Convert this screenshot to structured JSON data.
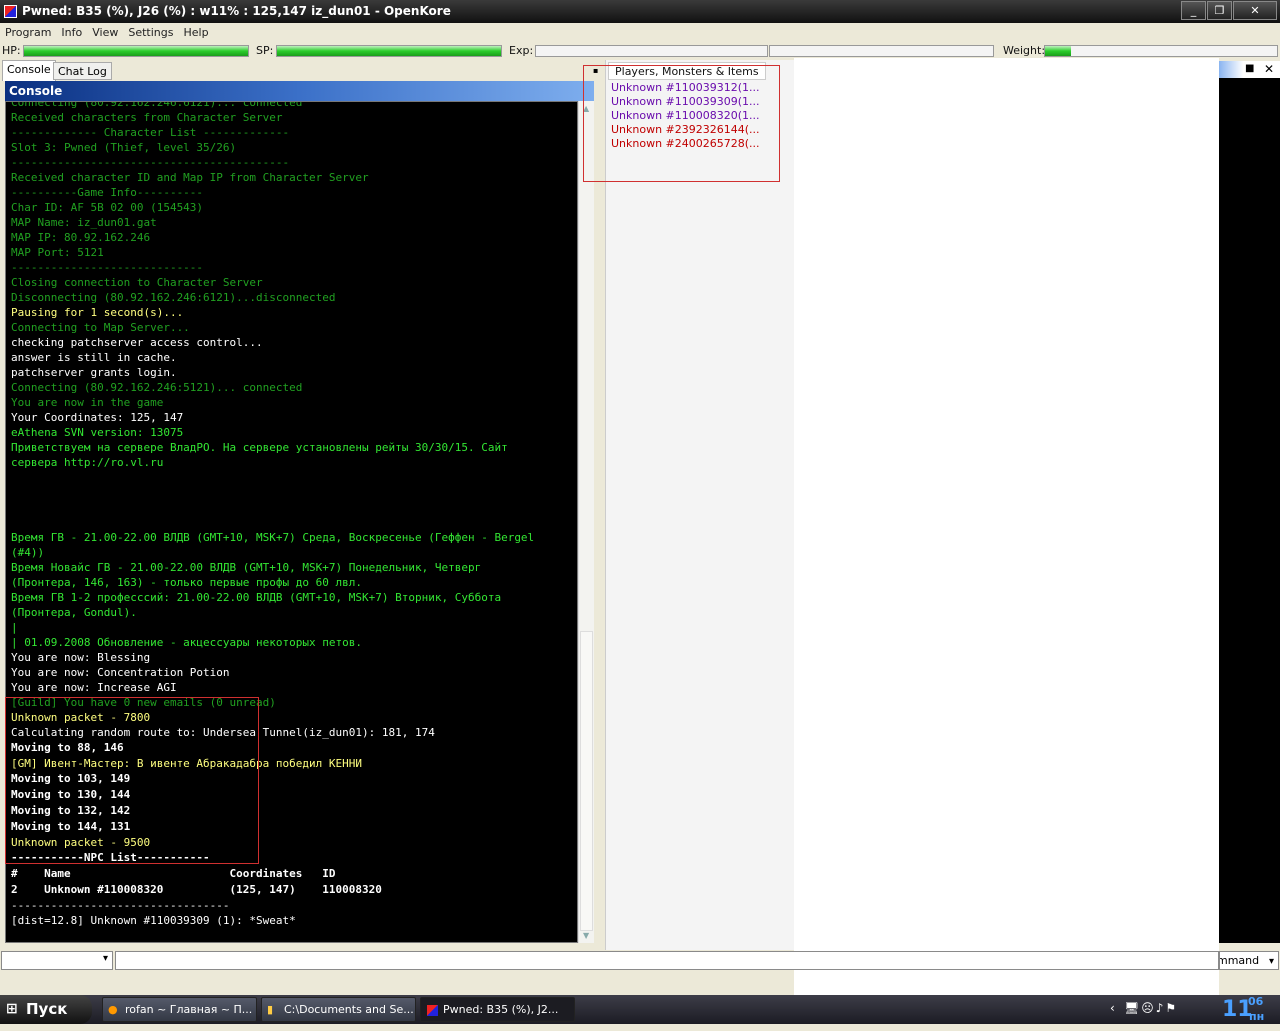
{
  "window": {
    "title": "Pwned:  B35 (%), J26 (%) : w11% : 125,147 iz_dun01 - OpenKore",
    "minimize": "_",
    "maximize": "❐",
    "close": "✕"
  },
  "menu": [
    "Program",
    "Info",
    "View",
    "Settings",
    "Help"
  ],
  "status": {
    "hp_label": "HP:",
    "hp": 100,
    "sp_label": "SP:",
    "sp": 100,
    "exp_label": "Exp:",
    "exp_base": 0,
    "exp_job": 0,
    "weight_label": "Weight:",
    "weight": 11
  },
  "tabs": [
    "Console",
    "Chat Log"
  ],
  "console": {
    "title": "Console",
    "lines": [
      {
        "t": "Connecting (80.92.162.246:6121)... connected",
        "c": "dg"
      },
      {
        "t": "Received characters from Character Server",
        "c": "dg"
      },
      {
        "t": "------------- Character List -------------",
        "c": "dg"
      },
      {
        "t": "Slot 3: Pwned (Thief, level 35/26)",
        "c": "dg"
      },
      {
        "t": "------------------------------------------",
        "c": "dg"
      },
      {
        "t": "Received character ID and Map IP from Character Server",
        "c": "dg"
      },
      {
        "t": "----------Game Info----------",
        "c": "dg"
      },
      {
        "t": "Char ID: AF 5B 02 00 (154543)",
        "c": "dg"
      },
      {
        "t": "MAP Name: iz_dun01.gat",
        "c": "dg"
      },
      {
        "t": "MAP IP: 80.92.162.246",
        "c": "dg"
      },
      {
        "t": "MAP Port: 5121",
        "c": "dg"
      },
      {
        "t": "-----------------------------",
        "c": "dg"
      },
      {
        "t": "Closing connection to Character Server",
        "c": "dg"
      },
      {
        "t": "Disconnecting (80.92.162.246:6121)...disconnected",
        "c": "dg"
      },
      {
        "t": "Pausing for 1 second(s)...",
        "c": "y"
      },
      {
        "t": "Connecting to Map Server...",
        "c": "dg"
      },
      {
        "t": "checking patchserver access control...",
        "c": "w"
      },
      {
        "t": "answer is still in cache.",
        "c": "w"
      },
      {
        "t": "patchserver grants login.",
        "c": "w"
      },
      {
        "t": "Connecting (80.92.162.246:5121)... connected",
        "c": "dg"
      },
      {
        "t": "You are now in the game",
        "c": "dg"
      },
      {
        "t": "Your Coordinates: 125, 147",
        "c": "w"
      },
      {
        "t": "eAthena SVN version: 13075",
        "c": "g"
      },
      {
        "t": "Приветствуем на сервере ВладРО. На сервере установлены рейты 30/30/15. Сайт",
        "c": "g"
      },
      {
        "t": "сервера http://ro.vl.ru",
        "c": "g"
      },
      {
        "t": "",
        "c": "g"
      },
      {
        "t": "",
        "c": "g"
      },
      {
        "t": "",
        "c": "g"
      },
      {
        "t": "",
        "c": "g"
      },
      {
        "t": "Время ГВ - 21.00-22.00 ВЛДВ (GMT+10, MSK+7) Среда, Воскресенье (Геффен - Bergel",
        "c": "g"
      },
      {
        "t": "(#4))",
        "c": "g"
      },
      {
        "t": "Время Новайс ГВ - 21.00-22.00 ВЛДВ (GMT+10, MSK+7) Понедельник, Четверг",
        "c": "g"
      },
      {
        "t": "(Пронтера, 146, 163) - только первые профы до 60 лвл.",
        "c": "g"
      },
      {
        "t": "Время ГВ 1-2 професссий: 21.00-22.00 ВЛДВ (GMT+10, MSK+7) Вторник, Суббота",
        "c": "g"
      },
      {
        "t": "(Пронтера, Gondul).",
        "c": "g"
      },
      {
        "t": "|",
        "c": "g"
      },
      {
        "t": "| 01.09.2008 Обновление - акцессуары некоторых петов.",
        "c": "g"
      },
      {
        "t": "You are now: Blessing",
        "c": "w"
      },
      {
        "t": "You are now: Concentration Potion",
        "c": "w"
      },
      {
        "t": "You are now: Increase AGI",
        "c": "w"
      },
      {
        "t": "[Guild] You have 0 new emails (0 unread)",
        "c": "dg"
      },
      {
        "t": "Unknown packet - 7800",
        "c": "y"
      },
      {
        "t": "Calculating random route to: Undersea Tunnel(iz_dun01): 181, 174",
        "c": "w"
      },
      {
        "t": "Moving to 88, 146",
        "c": "wb"
      },
      {
        "t": "[GM] Ивент-Мастер: В ивенте Абракадабра победил КЕННИ",
        "c": "y"
      },
      {
        "t": "Moving to 103, 149",
        "c": "wb"
      },
      {
        "t": "Moving to 130, 144",
        "c": "wb"
      },
      {
        "t": "Moving to 132, 142",
        "c": "wb"
      },
      {
        "t": "Moving to 144, 131",
        "c": "wb"
      },
      {
        "t": "Unknown packet - 9500",
        "c": "y"
      },
      {
        "t": "-----------NPC List-----------",
        "c": "wb"
      },
      {
        "t": "#    Name                        Coordinates   ID",
        "c": "wb"
      },
      {
        "t": "2    Unknown #110008320          (125, 147)    110008320",
        "c": "wb"
      },
      {
        "t": "---------------------------------",
        "c": "w"
      },
      {
        "t": "[dist=12.8] Unknown #110039309 (1): *Sweat*",
        "c": "w"
      }
    ]
  },
  "panel": {
    "tab": "Players, Monsters & Items",
    "items": [
      {
        "t": "Unknown #110039312(1...",
        "color": "#6a0dad"
      },
      {
        "t": "Unknown #110039309(1...",
        "color": "#6a0dad"
      },
      {
        "t": "Unknown #110008320(1...",
        "color": "#6a0dad"
      },
      {
        "t": "Unknown #2392326144(...",
        "color": "#c00000"
      },
      {
        "t": "Unknown #2400265728(...",
        "color": "#c00000"
      }
    ]
  },
  "right_panel": {
    "maximize": "■",
    "close": "✕"
  },
  "input": {
    "command_combo": "mmand",
    "arrow": "▾"
  },
  "taskbar": {
    "start": "Пуск",
    "tasks": [
      "rofan ~ Главная ~ П...",
      "C:\\Documents and Se...",
      "Pwned:  B35 (%), J2..."
    ],
    "tray_chevron": "‹",
    "clock": "11",
    "clock_sup": "06",
    "clock_day": "пн"
  },
  "colors": {
    "dg": "#21a021",
    "g": "#33e633",
    "y": "#ffff80",
    "w": "#ffffff",
    "wb": "#ffffff"
  }
}
